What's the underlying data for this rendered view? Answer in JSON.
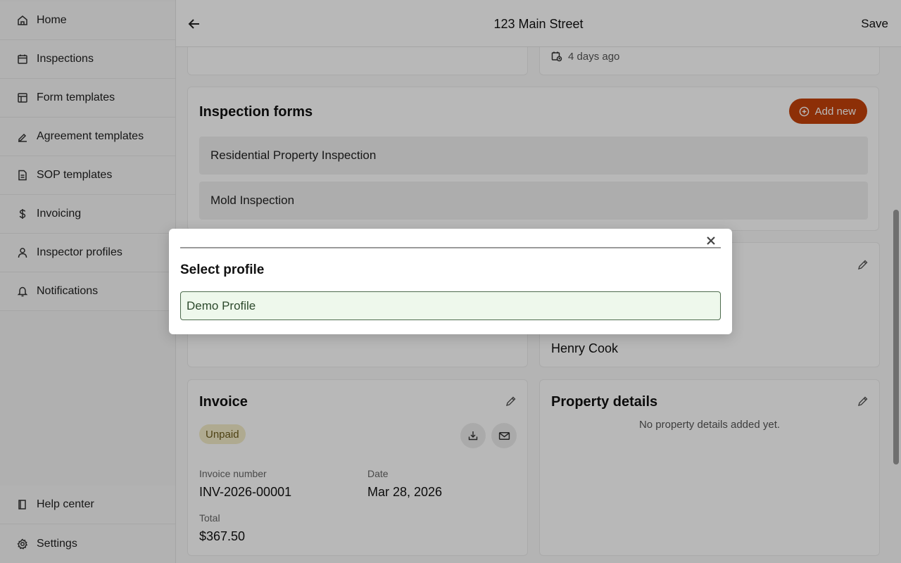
{
  "sidebar": {
    "items": [
      {
        "label": "Home",
        "icon": "home-icon"
      },
      {
        "label": "Inspections",
        "icon": "calendar-icon"
      },
      {
        "label": "Form templates",
        "icon": "layout-icon"
      },
      {
        "label": "Agreement templates",
        "icon": "signature-icon"
      },
      {
        "label": "SOP templates",
        "icon": "document-icon"
      },
      {
        "label": "Invoicing",
        "icon": "dollar-icon"
      },
      {
        "label": "Inspector profiles",
        "icon": "user-icon"
      },
      {
        "label": "Notifications",
        "icon": "bell-icon"
      }
    ],
    "bottom": [
      {
        "label": "Help center",
        "icon": "book-icon"
      },
      {
        "label": "Settings",
        "icon": "gear-icon"
      }
    ]
  },
  "header": {
    "title": "123 Main Street",
    "save_label": "Save"
  },
  "top_card": {
    "time_ago": "4 days ago"
  },
  "inspection_forms": {
    "title": "Inspection forms",
    "add_label": "Add new",
    "forms": [
      "Residential Property Inspection",
      "Mold Inspection"
    ]
  },
  "inspector_card": {
    "name": "Henry Cook"
  },
  "invoice": {
    "title": "Invoice",
    "status": "Unpaid",
    "number_label": "Invoice number",
    "number": "INV-2026-00001",
    "date_label": "Date",
    "date": "Mar 28, 2026",
    "total_label": "Total",
    "total": "$367.50"
  },
  "property_details": {
    "title": "Property details",
    "empty_text": "No property details added yet."
  },
  "dialog": {
    "title": "Select profile",
    "options": [
      "Demo Profile"
    ]
  },
  "colors": {
    "accent": "#c4420b",
    "selected_bg": "#eef8ec",
    "selected_border": "#4d6b4d"
  }
}
